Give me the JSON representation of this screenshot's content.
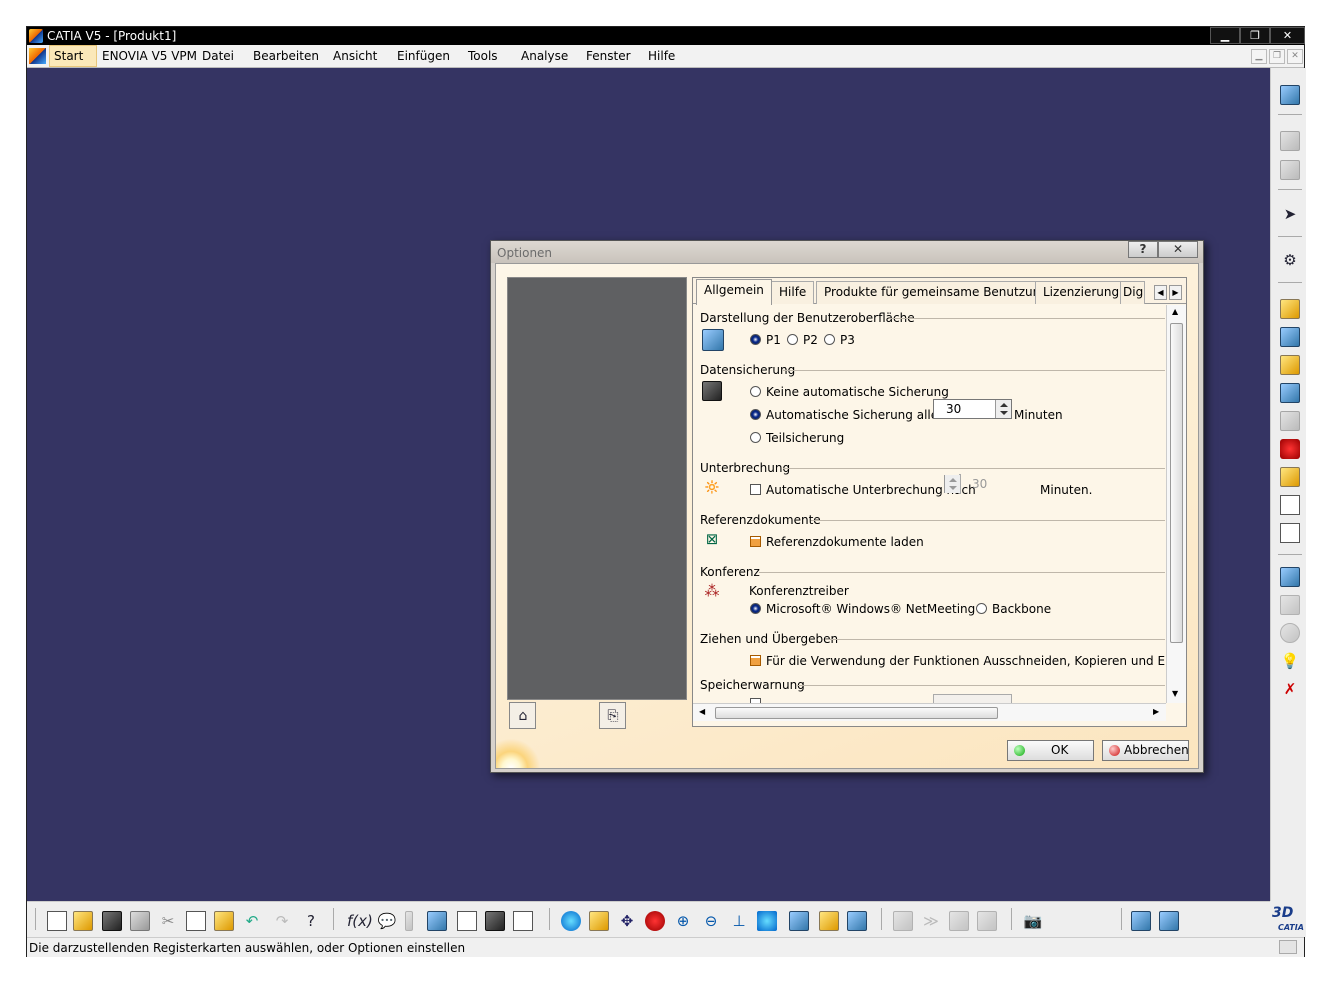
{
  "window": {
    "title": "CATIA V5 - [Produkt1]",
    "controls": {
      "minimize": "▁",
      "restore": "❐",
      "close": "✕"
    }
  },
  "menubar": {
    "items": [
      "Start",
      "ENOVIA V5 VPM",
      "Datei",
      "Bearbeiten",
      "Ansicht",
      "Einfügen",
      "Tools",
      "Analyse",
      "Fenster",
      "Hilfe"
    ]
  },
  "dialog": {
    "title": "Optionen",
    "help_label": "?",
    "close_label": "✕",
    "tabs": [
      "Allgemein",
      "Hilfe",
      "Produkte für gemeinsame Benutzung",
      "Lizenzierung",
      "Dig"
    ],
    "active_tab": "Allgemein",
    "sections": {
      "darstellung": {
        "title": "Darstellung der Benutzeroberfläche",
        "options": [
          "P1",
          "P2",
          "P3"
        ],
        "selected": "P1"
      },
      "datensicherung": {
        "title": "Datensicherung",
        "opt_none": "Keine automatische Sicherung",
        "opt_auto": "Automatische Sicherung alle",
        "interval": "30",
        "unit": "Minuten",
        "opt_partial": "Teilsicherung",
        "selected": "Automatische Sicherung alle"
      },
      "unterbrechung": {
        "title": "Unterbrechung",
        "checkbox": "Automatische Unterbrechung nach",
        "checked": false,
        "value": "30",
        "unit": "Minuten."
      },
      "referenz": {
        "title": "Referenzdokumente",
        "checkbox": "Referenzdokumente laden",
        "checked": true
      },
      "konferenz": {
        "title": "Konferenz",
        "label": "Konferenztreiber",
        "opt_netmeeting": "Microsoft® Windows® NetMeeting®",
        "opt_backbone": "Backbone",
        "selected": "Microsoft® Windows® NetMeeting®"
      },
      "ziehen": {
        "title": "Ziehen und Übergeben",
        "checkbox": "Für die Verwendung der Funktionen Ausschneiden, Kopieren und Einfügen c",
        "checked": true
      },
      "speicher": {
        "title": "Speicherwarnung"
      }
    },
    "ok_label": "OK",
    "cancel_label": "Abbrechen"
  },
  "statusbar": {
    "text": "Die darzustellenden Registerkarten auswählen, oder Optionen einstellen"
  },
  "logo": {
    "text": "CATIA"
  },
  "colors": {
    "workspace": "#353463",
    "dialog_body": "#fdf0d8",
    "tree_panel": "#5f6062",
    "menu_highlight": "#fbe8b9"
  }
}
